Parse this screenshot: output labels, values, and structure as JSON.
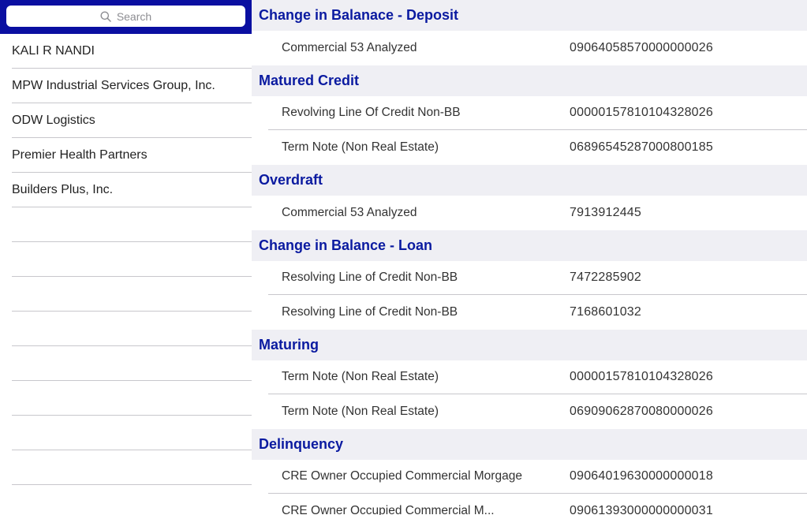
{
  "search": {
    "placeholder": "Search",
    "icon": "search-icon"
  },
  "clients": [
    "KALI R NANDI",
    "MPW Industrial Services Group, Inc.",
    "ODW Logistics",
    "Premier Health Partners",
    "Builders Plus, Inc.",
    "",
    "",
    "",
    "",
    "",
    "",
    "",
    ""
  ],
  "colors": {
    "search_bar_bg": "#0a0fa1",
    "section_header_text": "#0a1aa0",
    "section_header_bg": "#efeff4"
  },
  "sections": [
    {
      "title": "Change in Balanace - Deposit",
      "rows": [
        {
          "name": "Commercial 53 Analyzed",
          "account": "09064058570000000026"
        }
      ]
    },
    {
      "title": "Matured Credit",
      "rows": [
        {
          "name": "Revolving Line Of Credit Non-BB",
          "account": "00000157810104328026"
        },
        {
          "name": "Term Note (Non Real Estate)",
          "account": "06896545287000800185"
        }
      ]
    },
    {
      "title": "Overdraft",
      "rows": [
        {
          "name": "Commercial 53 Analyzed",
          "account": "7913912445"
        }
      ]
    },
    {
      "title": "Change in Balance - Loan",
      "rows": [
        {
          "name": "Resolving Line of Credit Non-BB",
          "account": "7472285902"
        },
        {
          "name": "Resolving Line of Credit Non-BB",
          "account": "7168601032"
        }
      ]
    },
    {
      "title": "Maturing",
      "rows": [
        {
          "name": "Term Note (Non Real Estate)",
          "account": "00000157810104328026"
        },
        {
          "name": "Term Note (Non Real Estate)",
          "account": "06909062870080000026"
        }
      ]
    },
    {
      "title": "Delinquency",
      "rows": [
        {
          "name": "CRE Owner Occupied Commercial Morgage",
          "account": "09064019630000000018"
        },
        {
          "name": "CRE Owner Occupied Commercial M...",
          "account": "09061393000000000031"
        }
      ]
    }
  ]
}
